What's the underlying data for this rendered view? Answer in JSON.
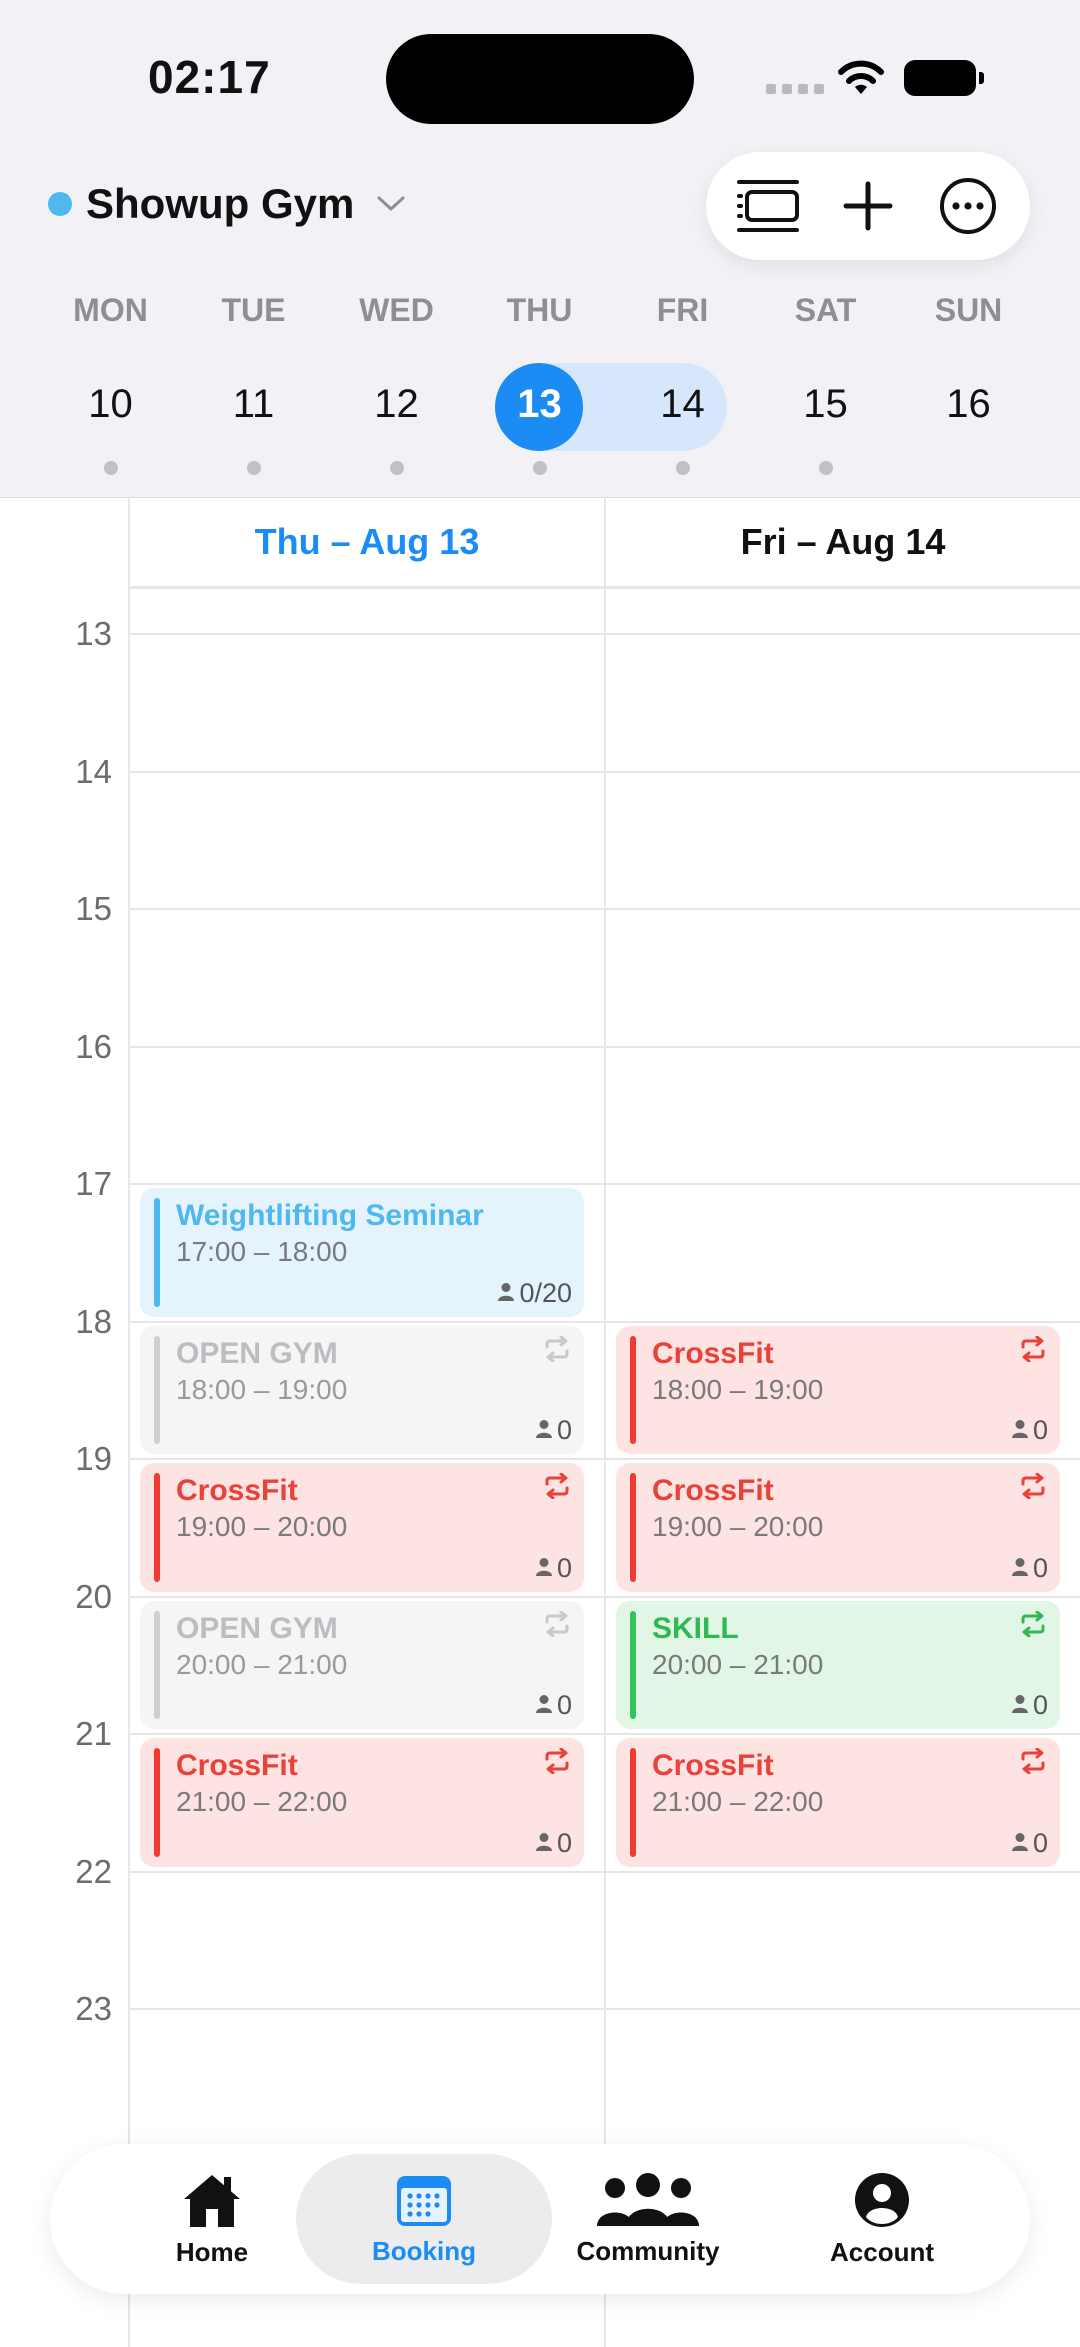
{
  "status_bar": {
    "time": "02:17"
  },
  "header": {
    "gym_name": "Showup Gym",
    "gym_color": "#4fb8f0",
    "actions": [
      "list-view-icon",
      "plus-icon",
      "more-icon"
    ]
  },
  "week": {
    "days": [
      {
        "weekday": "MON",
        "date": "10",
        "has_events": true
      },
      {
        "weekday": "TUE",
        "date": "11",
        "has_events": true
      },
      {
        "weekday": "WED",
        "date": "12",
        "has_events": true
      },
      {
        "weekday": "THU",
        "date": "13",
        "has_events": true,
        "selected": true
      },
      {
        "weekday": "FRI",
        "date": "14",
        "has_events": true,
        "in_range": true
      },
      {
        "weekday": "SAT",
        "date": "15",
        "has_events": true
      },
      {
        "weekday": "SUN",
        "date": "16",
        "has_events": false
      }
    ],
    "accent": "#1a8cf3"
  },
  "calendar": {
    "columns": [
      {
        "label": "Thu – Aug 13",
        "active": true
      },
      {
        "label": "Fri – Aug 14",
        "active": false
      }
    ],
    "hours": [
      "13",
      "14",
      "15",
      "16",
      "17",
      "18",
      "19",
      "20",
      "21",
      "22",
      "23"
    ],
    "events": [
      {
        "column": 0,
        "start": 17,
        "end": 18,
        "title": "Weightlifting Seminar",
        "range": "17:00 – 18:00",
        "count": "0/20",
        "style": "blue",
        "repeat": false
      },
      {
        "column": 0,
        "start": 18,
        "end": 19,
        "title": "OPEN GYM",
        "range": "18:00 – 19:00",
        "count": "0",
        "style": "grey",
        "repeat": true
      },
      {
        "column": 0,
        "start": 19,
        "end": 20,
        "title": "CrossFit",
        "range": "19:00 – 20:00",
        "count": "0",
        "style": "red",
        "repeat": true
      },
      {
        "column": 0,
        "start": 20,
        "end": 21,
        "title": "OPEN GYM",
        "range": "20:00 – 21:00",
        "count": "0",
        "style": "grey",
        "repeat": true
      },
      {
        "column": 0,
        "start": 21,
        "end": 22,
        "title": "CrossFit",
        "range": "21:00 – 22:00",
        "count": "0",
        "style": "red",
        "repeat": true
      },
      {
        "column": 1,
        "start": 18,
        "end": 19,
        "title": "CrossFit",
        "range": "18:00 – 19:00",
        "count": "0",
        "style": "red",
        "repeat": true
      },
      {
        "column": 1,
        "start": 19,
        "end": 20,
        "title": "CrossFit",
        "range": "19:00 – 20:00",
        "count": "0",
        "style": "red",
        "repeat": true
      },
      {
        "column": 1,
        "start": 20,
        "end": 21,
        "title": "SKILL",
        "range": "20:00 – 21:00",
        "count": "0",
        "style": "green",
        "repeat": true
      },
      {
        "column": 1,
        "start": 21,
        "end": 22,
        "title": "CrossFit",
        "range": "21:00 – 22:00",
        "count": "0",
        "style": "red",
        "repeat": true
      }
    ]
  },
  "tabbar": {
    "tabs": [
      {
        "label": "Home",
        "icon": "home-icon",
        "active": false
      },
      {
        "label": "Booking",
        "icon": "calendar-icon",
        "active": true
      },
      {
        "label": "Community",
        "icon": "community-icon",
        "active": false
      },
      {
        "label": "Account",
        "icon": "account-icon",
        "active": false
      }
    ]
  }
}
